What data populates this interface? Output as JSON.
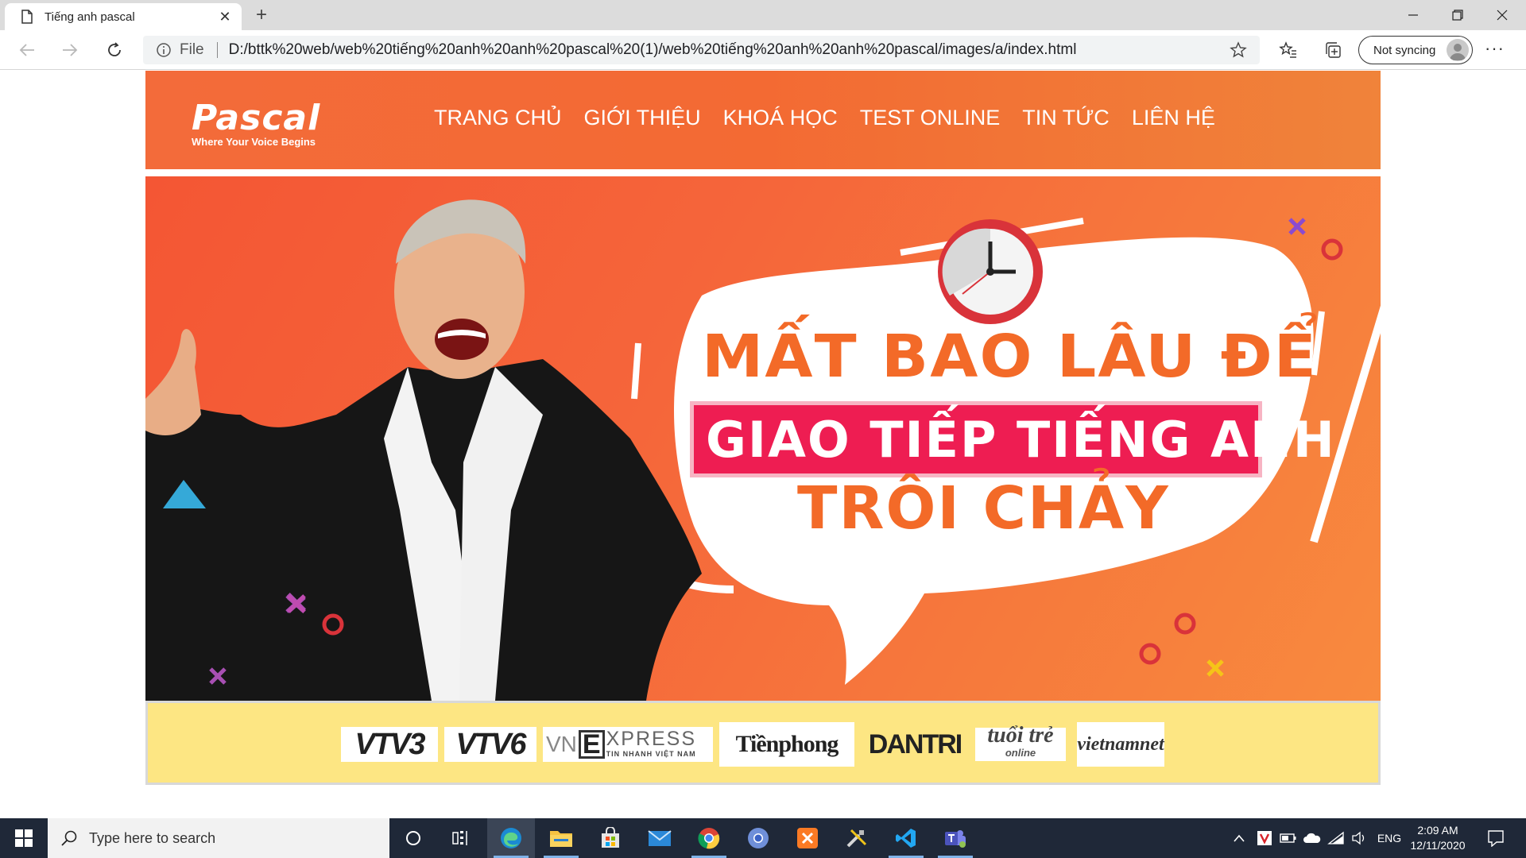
{
  "browser": {
    "tab_title": "Tiếng anh pascal",
    "new_tab_symbol": "+",
    "address_scheme_label": "File",
    "url": "D:/bttk%20web/web%20tiếng%20anh%20anh%20pascal%20(1)/web%20tiếng%20anh%20anh%20pascal/images/a/index.html",
    "sync_label": "Not syncing",
    "more_symbol": "···"
  },
  "site": {
    "logo_text": "Pascal",
    "logo_tagline": "Where Your Voice Begins",
    "nav": [
      "TRANG CHỦ",
      "GIỚI THIỆU",
      "KHOÁ HỌC",
      "TEST ONLINE",
      "TIN TỨC",
      "LIÊN HỆ"
    ],
    "accent_color": "#f36a33",
    "banner": {
      "line1": "MẤT BAO LÂU ĐỂ",
      "line2": "GIAO TIẾP TIẾNG ANH",
      "line3": "TRÔI CHẢY"
    },
    "press_logos": [
      "VTV3",
      "VTV6",
      "VN",
      "XPRESS",
      "TIN NHANH VIỆT NAM",
      "Tiềnphong",
      "DANTRI",
      "tuổi trẻ",
      "online",
      "vietnamnet"
    ]
  },
  "taskbar": {
    "search_placeholder": "Type here to search",
    "language": "ENG",
    "time": "2:09 AM",
    "date": "12/11/2020"
  }
}
